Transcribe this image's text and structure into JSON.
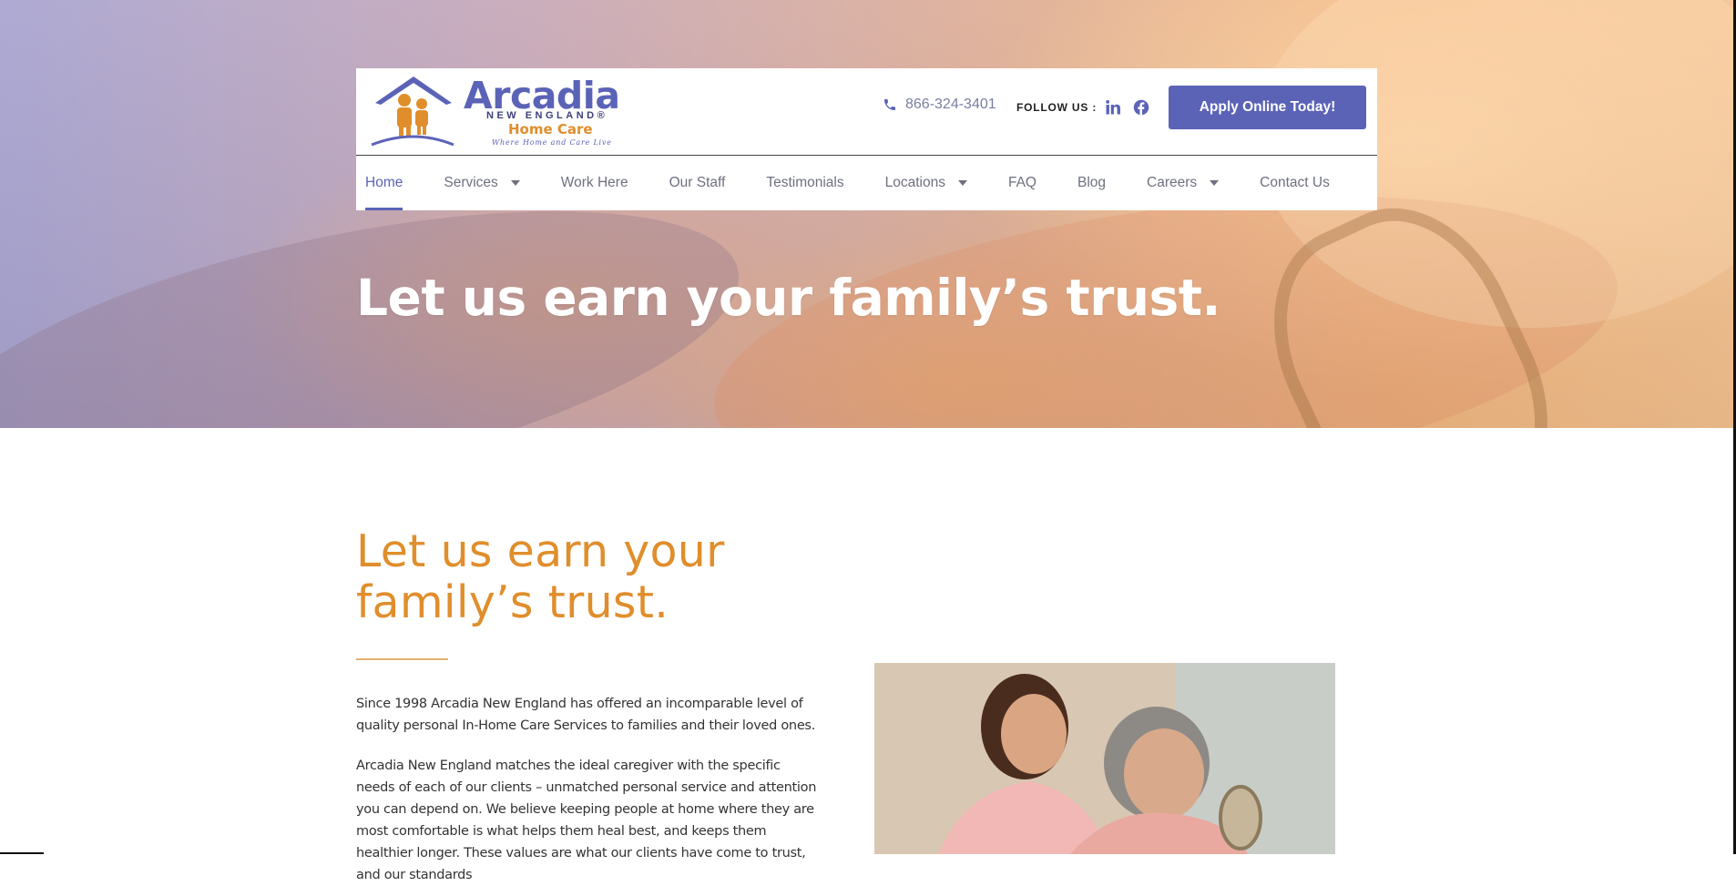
{
  "header": {
    "logo": {
      "word": "Arcadia",
      "subline": "NEW ENGLAND®",
      "product": "Home Care",
      "tagline": "Where Home and Care Live"
    },
    "phone": "866-324-3401",
    "follow_label": "FOLLOW US :",
    "social": [
      "linkedin-icon",
      "facebook-icon"
    ],
    "apply_label": "Apply Online Today!",
    "brand_color": "#5b63b7",
    "accent_color": "#e08e2c"
  },
  "nav": {
    "items": [
      {
        "label": "Home",
        "active": true,
        "dropdown": false
      },
      {
        "label": "Services",
        "active": false,
        "dropdown": true
      },
      {
        "label": "Work Here",
        "active": false,
        "dropdown": false
      },
      {
        "label": "Our Staff",
        "active": false,
        "dropdown": false
      },
      {
        "label": "Testimonials",
        "active": false,
        "dropdown": false
      },
      {
        "label": "Locations",
        "active": false,
        "dropdown": true
      },
      {
        "label": "FAQ",
        "active": false,
        "dropdown": false
      },
      {
        "label": "Blog",
        "active": false,
        "dropdown": false
      },
      {
        "label": "Careers",
        "active": false,
        "dropdown": true
      },
      {
        "label": "Contact Us",
        "active": false,
        "dropdown": false
      }
    ]
  },
  "hero": {
    "title": "Let us earn your family’s trust."
  },
  "content": {
    "title": "Let us earn your family’s trust.",
    "paragraph_1": "Since 1998 Arcadia New England has offered an incomparable level of quality personal In-Home Care Services to families and their loved ones.",
    "paragraph_2": "Arcadia New England matches the ideal caregiver with the specific needs of each of our clients – unmatched personal service and attention you can depend on. We believe keeping people at home where they are most comfortable is what helps them heal best, and keeps them healthier longer. These values are what our clients have come to trust, and our standards"
  }
}
